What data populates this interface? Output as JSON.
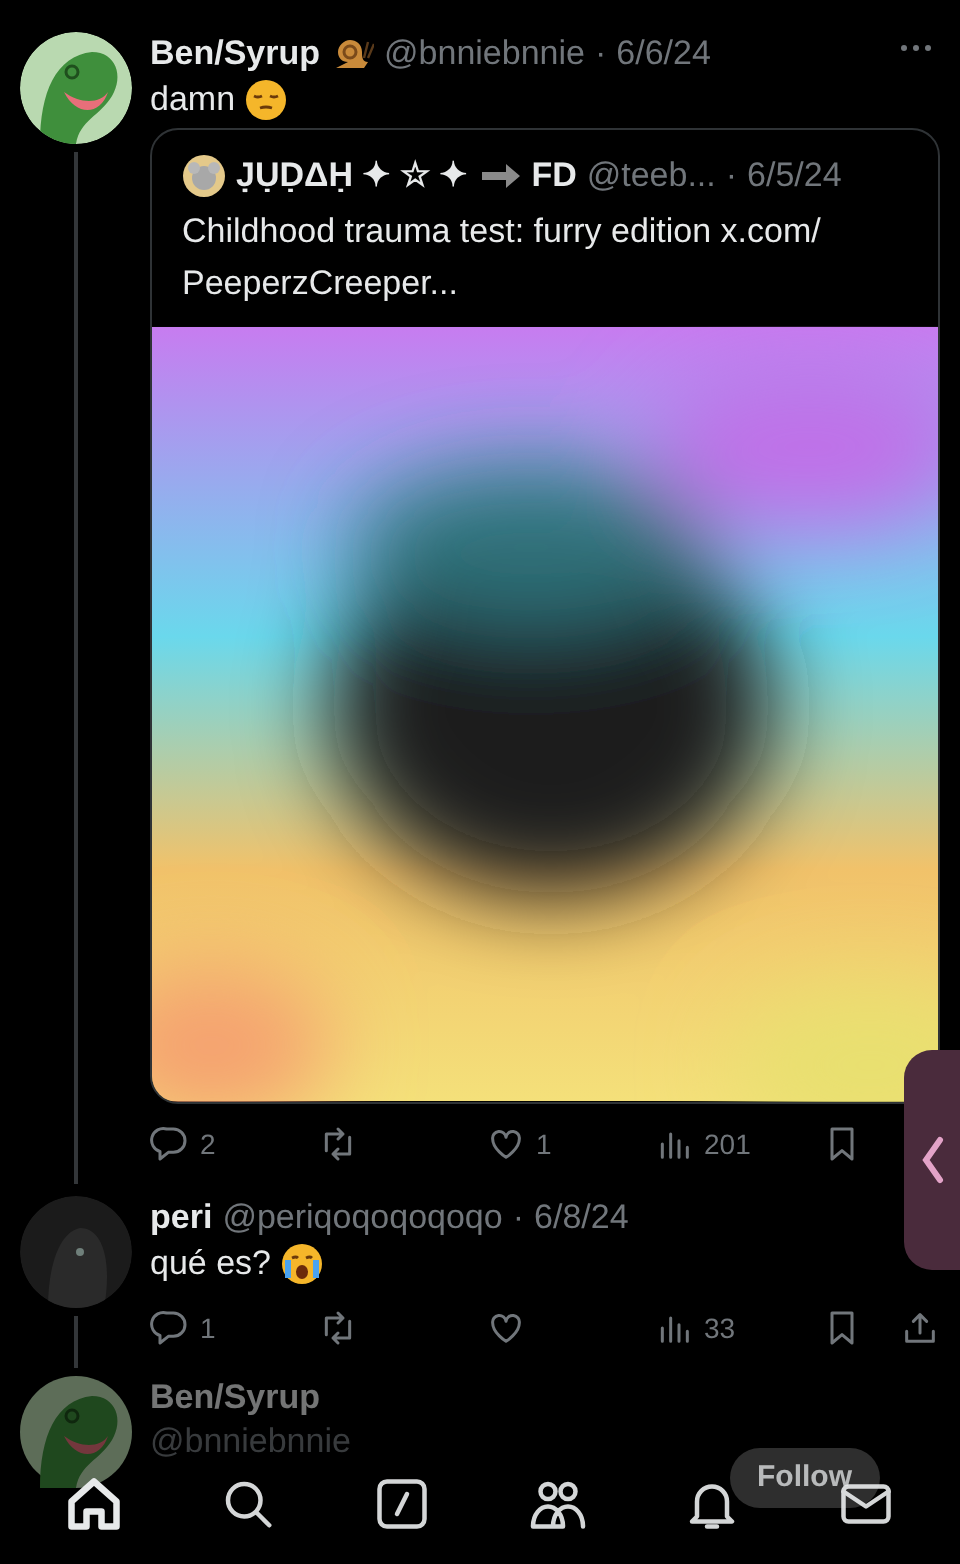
{
  "tweets": [
    {
      "author": "Ben/Syrup",
      "handle": "@bnniebnnie",
      "separator": "·",
      "date": "6/6/24",
      "text": "damn",
      "thread_line": true,
      "quote": {
        "author": "J̣ỤḌΔḤ ✦ ☆ ✦",
        "author_suffix": "FD",
        "handle": "@teeb...",
        "separator": "·",
        "date": "6/5/24",
        "text": "Childhood trauma test: furry edition x.com/ PeeperzCreeper..."
      },
      "actions": [
        {
          "kind": "reply",
          "count": "2"
        },
        {
          "kind": "repost"
        },
        {
          "kind": "like",
          "count": "1"
        },
        {
          "kind": "views",
          "count": "201"
        },
        {
          "kind": "bookmark"
        }
      ]
    },
    {
      "author": "peri",
      "handle": "@periqoqoqoqoqo",
      "separator": "·",
      "date": "6/8/24",
      "text": "qué es?",
      "thread_line": true,
      "actions": [
        {
          "kind": "reply",
          "count": "1"
        },
        {
          "kind": "repost"
        },
        {
          "kind": "like"
        },
        {
          "kind": "views",
          "count": "33"
        },
        {
          "kind": "bookmark"
        },
        {
          "kind": "share"
        }
      ]
    }
  ],
  "next_tweet": {
    "author": "Ben/Syrup",
    "handle": "@bnniebnnie",
    "follow_label": "Follow"
  },
  "bottom_nav": [
    {
      "kind": "home",
      "selected": true
    },
    {
      "kind": "search",
      "selected": false
    },
    {
      "kind": "compose",
      "selected": false
    },
    {
      "kind": "communities",
      "selected": false
    },
    {
      "kind": "notifications",
      "selected": false
    },
    {
      "kind": "messages",
      "selected": false
    }
  ]
}
